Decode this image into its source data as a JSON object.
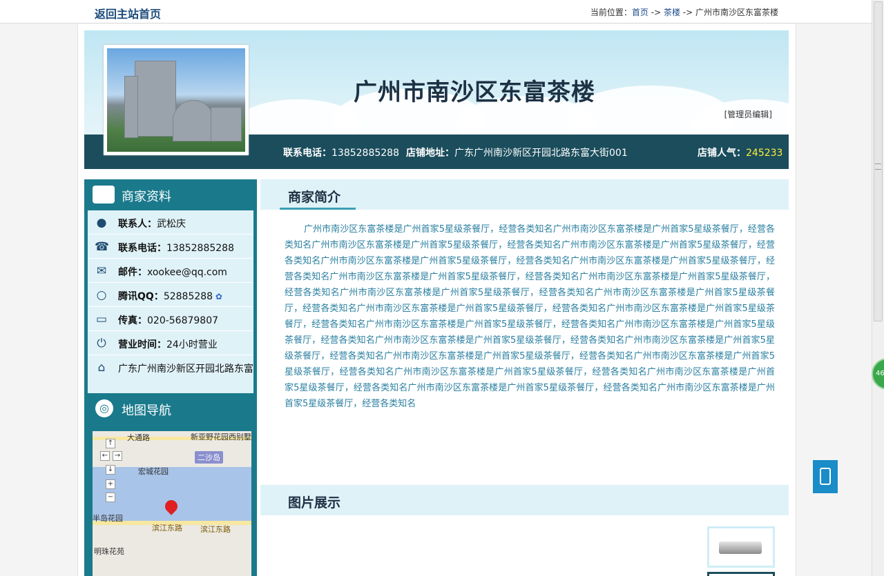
{
  "topbar": {
    "home_link": "返回主站首页",
    "crumb_prefix": "当前位置：",
    "crumb_home": "首页",
    "crumb_sep": " -> ",
    "crumb_category": "茶楼",
    "crumb_current": "广州市南沙区东富茶楼"
  },
  "banner": {
    "title": "广州市南沙区东富茶楼",
    "admin_edit": "[管理员编辑]",
    "phone_label": "联系电话：",
    "phone_value": "13852885288",
    "address_label": "店铺地址：",
    "address_value": "广东广州南沙新区开园北路东富大街001",
    "popularity_label": "店铺人气：",
    "popularity_value": "245233"
  },
  "sidebar": {
    "merchant_heading": "商家资料",
    "rows": [
      {
        "icon": "person-icon",
        "label": "联系人：",
        "value": "武松庆"
      },
      {
        "icon": "phone-icon",
        "label": "联系电话：",
        "value": "13852885288"
      },
      {
        "icon": "mail-icon",
        "label": "邮件：",
        "value": "xookee@qq.com"
      },
      {
        "icon": "search-icon",
        "label": "腾讯QQ：",
        "value": "52885288"
      },
      {
        "icon": "monitor-icon",
        "label": "传真：",
        "value": "020-56879807"
      },
      {
        "icon": "power-icon",
        "label": "营业时间：",
        "value": "24小时营业"
      },
      {
        "icon": "home-icon",
        "label": "",
        "value": "广东广州南沙新区开园北路东富"
      }
    ],
    "map_heading": "地图导航",
    "map_labels": {
      "road_top": "大通路",
      "top_right": "新亚野花园西别墅",
      "island": "二沙岛",
      "garden": "宏城花园",
      "garden_left": "半岛花园",
      "road_1": "滨江东路",
      "road_2": "滨江东路",
      "bottom": "明珠花苑"
    }
  },
  "content": {
    "intro_heading": "商家简介",
    "intro_text": "广州市南沙区东富茶楼是广州首家5星级茶餐厅，经营各类知名广州市南沙区东富茶楼是广州首家5星级茶餐厅，经营各类知名广州市南沙区东富茶楼是广州首家5星级茶餐厅，经营各类知名广州市南沙区东富茶楼是广州首家5星级茶餐厅，经营各类知名广州市南沙区东富茶楼是广州首家5星级茶餐厅，经营各类知名广州市南沙区东富茶楼是广州首家5星级茶餐厅，经营各类知名广州市南沙区东富茶楼是广州首家5星级茶餐厅，经营各类知名广州市南沙区东富茶楼是广州首家5星级茶餐厅，经营各类知名广州市南沙区东富茶楼是广州首家5星级茶餐厅，经营各类知名广州市南沙区东富茶楼是广州首家5星级茶餐厅，经营各类知名广州市南沙区东富茶楼是广州首家5星级茶餐厅，经营各类知名广州市南沙区东富茶楼是广州首家5星级茶餐厅，经营各类知名广州市南沙区东富茶楼是广州首家5星级茶餐厅，经营各类知名广州市南沙区东富茶楼是广州首家5星级茶餐厅，经营各类知名广州市南沙区东富茶楼是广州首家5星级茶餐厅，经营各类知名广州市南沙区东富茶楼是广州首家5星级茶餐厅，经营各类知名广州市南沙区东富茶楼是广州首家5星级茶餐厅，经营各类知名广州市南沙区东富茶楼是广州首家5星级茶餐厅，经营各类知名广州市南沙区东富茶楼是广州首家5星级茶餐厅，经营各类知名广州市南沙区东富茶楼是广州首家5星级茶餐厅，经营各类知名广州市南沙区东富茶楼是广州首家5星级茶餐厅，经营各类知名广州市南沙区东富茶楼是广州首家5星级茶餐厅，经营各类知名",
    "gallery_heading": "图片展示"
  },
  "floating": {
    "badge_text": "46"
  },
  "colors": {
    "sidebar": "#1a7a8c",
    "infobar": "#1b4d5c",
    "popularity": "#ffef3a",
    "intro_text": "#2a7fa0"
  }
}
